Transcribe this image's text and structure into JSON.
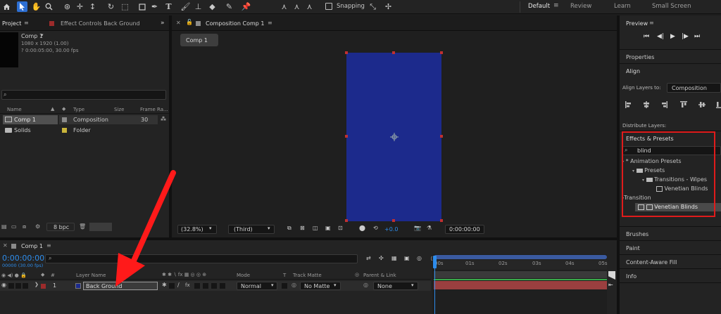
{
  "toolbar": {
    "snapping_label": "Snapping",
    "workspaces": [
      "Default",
      "Review",
      "Learn",
      "Small Screen"
    ]
  },
  "project": {
    "tab_project": "Project",
    "tab_effect_controls": "Effect Controls Back Ground",
    "comp_name": "Comp 1",
    "comp_dims": "1080 x 1920 (1.00)",
    "comp_duration": "? 0:00:05:00, 30.00 fps",
    "columns": [
      "Name",
      "Type",
      "Size",
      "Frame Ra..."
    ],
    "rows": [
      {
        "name": "Comp 1",
        "type": "Composition",
        "size": "",
        "fps": "30",
        "color": "#8a8a8a"
      },
      {
        "name": "Solids",
        "type": "Folder",
        "size": "",
        "fps": "",
        "color": "#c9b43a"
      }
    ],
    "bpc": "8 bpc"
  },
  "composition": {
    "tab_label": "Composition Comp 1",
    "flowchart_label": "Comp 1",
    "zoom": "(32.8%)",
    "view": "(Third)",
    "exposure": "+0.0",
    "timecode": "0:00:00:00",
    "solid_color": "#1c2a8c"
  },
  "right": {
    "preview_label": "Preview",
    "properties_label": "Properties",
    "align_label": "Align",
    "align_layers_to_label": "Align Layers to:",
    "align_layers_to_value": "Composition",
    "distribute_label": "Distribute Layers:",
    "effects_presets_label": "Effects & Presets",
    "search_value": "blind",
    "tree": [
      {
        "label": "* Animation Presets",
        "indent": 0,
        "kind": "chev"
      },
      {
        "label": "Presets",
        "indent": 1,
        "kind": "folder"
      },
      {
        "label": "Transitions - Wipes",
        "indent": 2,
        "kind": "folder"
      },
      {
        "label": "Venetian Blinds",
        "indent": 3,
        "kind": "preset"
      },
      {
        "label": "Transition",
        "indent": 0,
        "kind": "chev"
      },
      {
        "label": "Venetian Blinds",
        "indent": 2,
        "kind": "effect"
      }
    ],
    "lower_panels": [
      "Brushes",
      "Paint",
      "Content-Aware Fill",
      "Info"
    ],
    "highlight_color": "#e01b1b"
  },
  "timeline": {
    "tab_label": "Comp 1",
    "timecode": "0:00:00:00",
    "frames_line": "00000 (30.00 fps)",
    "col_layer_name": "Layer Name",
    "col_mode": "Mode",
    "col_t": "T",
    "col_track_matte": "Track Matte",
    "col_parent": "Parent & Link",
    "layer_number": "1",
    "layer_name": "Back Ground",
    "layer_mode": "Normal",
    "layer_matte": "No Matte",
    "layer_parent": "None",
    "ruler": [
      "00s",
      "01s",
      "02s",
      "03s",
      "04s",
      "05s"
    ],
    "bar_color": "#9a3f3f"
  },
  "annotation": {
    "arrow_color": "#ff1a1a"
  }
}
